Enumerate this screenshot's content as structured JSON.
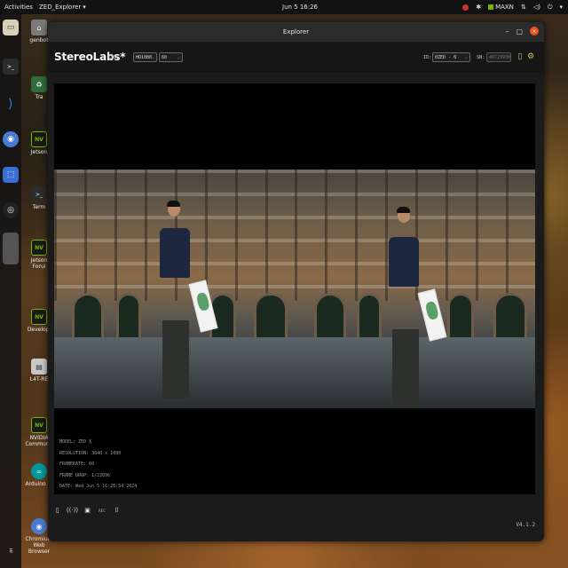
{
  "topbar": {
    "activities": "Activities",
    "app_menu": "ZED_Explorer",
    "app_menu_arrow": "▾",
    "clock": "Jun 5  16:26",
    "tray_label": "MAXN",
    "tray_caret": "▾"
  },
  "dock": {
    "items": [
      {
        "name": "files-icon",
        "color": "#d9d0b8",
        "glyph": "▭"
      },
      {
        "name": "terminal-icon",
        "color": "#2c2c2c",
        "glyph": ">_"
      },
      {
        "name": "vscode-icon",
        "color": "#1e6fc0",
        "glyph": "≺"
      },
      {
        "name": "chromium-icon",
        "color": "#4a7bd4",
        "glyph": "◉"
      },
      {
        "name": "screenshot-icon",
        "color": "#3a6fd8",
        "glyph": "⬚"
      },
      {
        "name": "obs-icon",
        "color": "#222222",
        "glyph": "◎"
      },
      {
        "name": "app-placeholder-icon",
        "color": "#555555",
        "glyph": ""
      },
      {
        "name": "show-apps-icon",
        "color": "#1b1b1b",
        "glyph": "⋮⋮⋮"
      }
    ]
  },
  "desktop": {
    "icons": [
      {
        "label": "genbot",
        "glyph": "⌂"
      },
      {
        "label": "Tra",
        "glyph": "♻"
      },
      {
        "label": "Jetson",
        "glyph": "NVIDIA"
      },
      {
        "label": "Term",
        "glyph": ">_"
      },
      {
        "label": "Jetson Forui",
        "glyph": "NVIDIA"
      },
      {
        "label": "Developi",
        "glyph": "NVIDIA"
      },
      {
        "label": "L4T-RE",
        "glyph": "▤"
      },
      {
        "label": "NVIDIA Communit",
        "glyph": "NVIDIA"
      },
      {
        "label": "Arduino IC",
        "glyph": "∞"
      },
      {
        "label": "Chromium Web Browser",
        "glyph": "◉"
      }
    ]
  },
  "window": {
    "title": "Explorer",
    "minimize": "–",
    "maximize": "▢",
    "close": "×"
  },
  "header": {
    "brand": "StereoLabs*",
    "live": "LIVE",
    "resolution": "HD1080",
    "fps": "60",
    "chevron": "⌵",
    "id_label": "ID:",
    "id_value": "0ZED - 0",
    "sn_label": "SN:",
    "sn_value": "40729930"
  },
  "info": {
    "model": "MODEL: ZED X",
    "resolution": "RESOLUTION: 3840 x 1080",
    "framerate": "FRAMERATE: 60",
    "frame_drop": "FRAME DROP: 1/23096",
    "date": "DATE: Wed Jun 5 16:26:54 2024"
  },
  "footer": {
    "rec_label": "REC",
    "version": "V4.1.2"
  },
  "colors": {
    "accent": "#e0c060",
    "close": "#e95420",
    "nvidia": "#76b900"
  }
}
